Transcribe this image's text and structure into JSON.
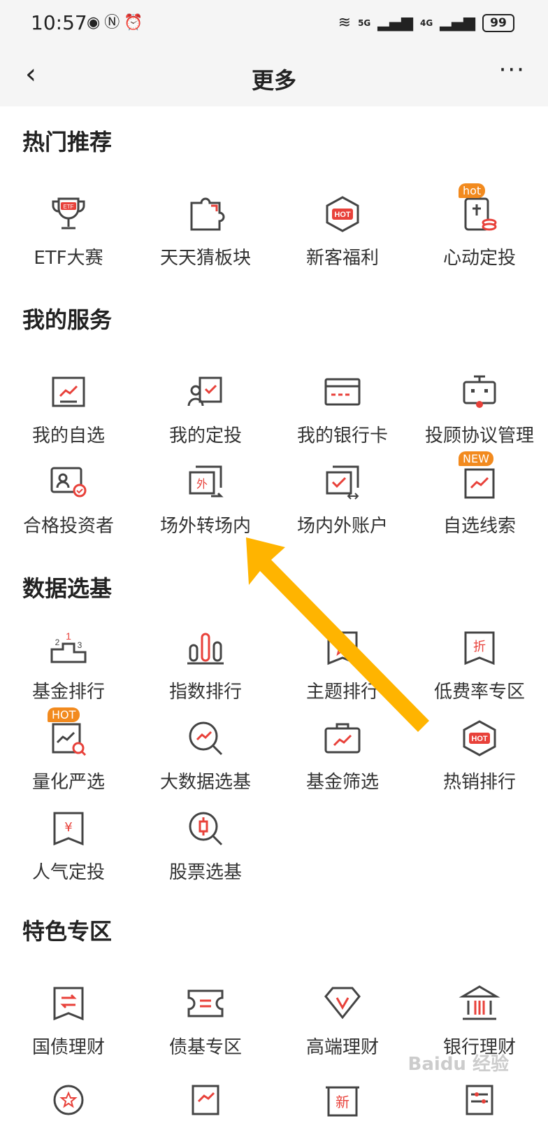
{
  "status": {
    "time": "10:57",
    "signal_a": "5G",
    "signal_b": "4G",
    "battery": "99"
  },
  "nav": {
    "title": "更多",
    "back": "‹",
    "more": "···"
  },
  "sections": [
    {
      "title": "热门推荐",
      "items": [
        {
          "label": "ETF大赛",
          "icon": "trophy-etf-icon"
        },
        {
          "label": "天天猜板块",
          "icon": "puzzle-icon"
        },
        {
          "label": "新客福利",
          "icon": "hot-hexagon-icon"
        },
        {
          "label": "心动定投",
          "icon": "tablet-coins-icon",
          "badge": "hot"
        }
      ]
    },
    {
      "title": "我的服务",
      "items": [
        {
          "label": "我的自选",
          "icon": "chart-board-icon"
        },
        {
          "label": "我的定投",
          "icon": "user-calendar-icon"
        },
        {
          "label": "我的银行卡",
          "icon": "bank-card-icon"
        },
        {
          "label": "投顾协议管理",
          "icon": "robot-icon"
        },
        {
          "label": "合格投资者",
          "icon": "certified-id-icon"
        },
        {
          "label": "场外转场内",
          "icon": "transfer-out-icon"
        },
        {
          "label": "场内外账户",
          "icon": "account-switch-icon"
        },
        {
          "label": "自选线索",
          "icon": "chart-clue-icon",
          "badge": "NEW"
        }
      ]
    },
    {
      "title": "数据选基",
      "items": [
        {
          "label": "基金排行",
          "icon": "podium-icon"
        },
        {
          "label": "指数排行",
          "icon": "bars-icon"
        },
        {
          "label": "主题排行",
          "icon": "star-ribbon-icon"
        },
        {
          "label": "低费率专区",
          "icon": "discount-ribbon-icon"
        },
        {
          "label": "量化严选",
          "icon": "chart-search-icon",
          "badge": "HOT"
        },
        {
          "label": "大数据选基",
          "icon": "magnifier-trend-icon"
        },
        {
          "label": "基金筛选",
          "icon": "briefcase-trend-icon"
        },
        {
          "label": "热销排行",
          "icon": "hot-hexagon-icon"
        },
        {
          "label": "人气定投",
          "icon": "yen-ribbon-icon"
        },
        {
          "label": "股票选基",
          "icon": "magnifier-candle-icon"
        }
      ]
    },
    {
      "title": "特色专区",
      "items": [
        {
          "label": "国债理财",
          "icon": "exchange-ribbon-icon"
        },
        {
          "label": "债基专区",
          "icon": "ticket-icon"
        },
        {
          "label": "高端理财",
          "icon": "diamond-v-icon"
        },
        {
          "label": "银行理财",
          "icon": "bank-building-icon"
        }
      ]
    }
  ],
  "overflow_icons": [
    "star-circle-icon",
    "trend-box-icon",
    "new-sign-icon",
    "list-settings-icon"
  ],
  "overflow_sign": "新",
  "watermark": "Baidu 经验",
  "colors": {
    "accent": "#e8413a",
    "badge": "#f28a1e",
    "arrow": "#ffb400",
    "text": "#333333"
  }
}
